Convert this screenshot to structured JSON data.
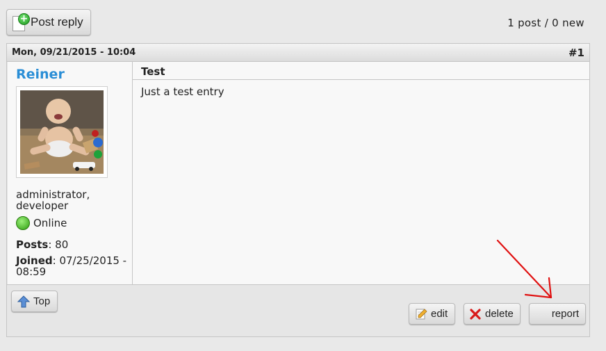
{
  "toolbar": {
    "post_reply_label": "Post reply",
    "post_count": "1 post / 0 new"
  },
  "post": {
    "date": "Mon, 09/21/2015 - 10:04",
    "number": "#1",
    "subject": "Test",
    "body": "Just a test entry"
  },
  "author": {
    "name": "Reiner",
    "roles": "administrator, developer",
    "status": "Online",
    "posts_label": "Posts",
    "posts_value": ": 80",
    "joined_label": "Joined",
    "joined_value": ": 07/25/2015 - 08:59"
  },
  "footer": {
    "top_label": "Top",
    "edit_label": "edit",
    "delete_label": "delete",
    "report_label": "report"
  },
  "icons": {
    "post_reply": "document-plus-icon",
    "top": "arrow-up-icon",
    "edit": "pencil-note-icon",
    "delete": "red-x-icon",
    "status": "green-dot-icon"
  },
  "colors": {
    "author_name": "#2a8ed6",
    "annotation": "#e01010",
    "online": "#2e9d10"
  }
}
